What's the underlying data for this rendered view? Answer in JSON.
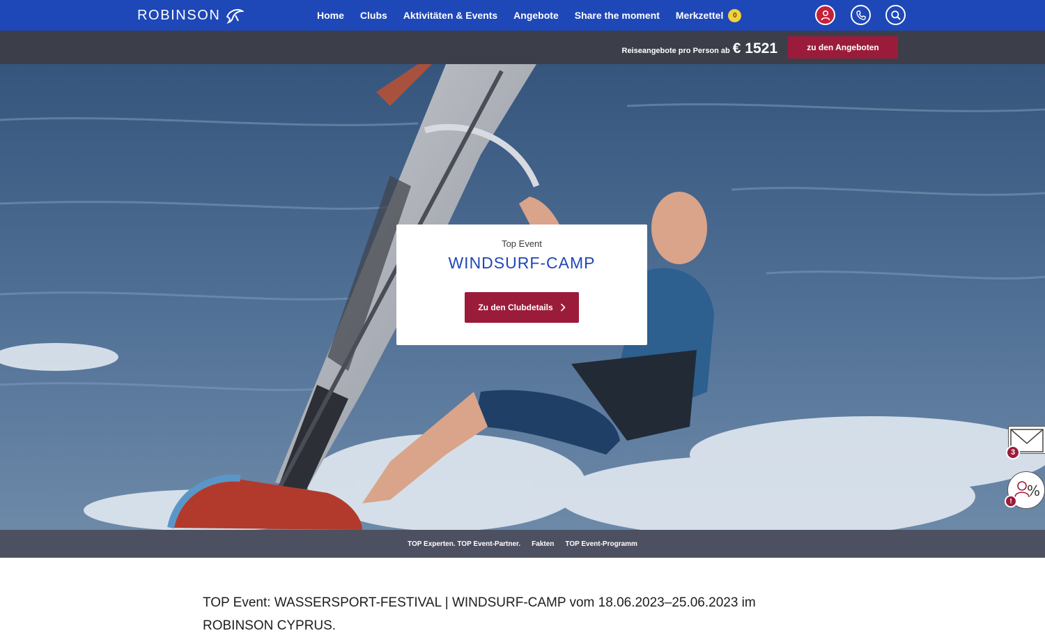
{
  "header": {
    "logo_text": "ROBINSON",
    "nav": [
      {
        "label": "Home"
      },
      {
        "label": "Clubs"
      },
      {
        "label": "Aktivitäten & Events"
      },
      {
        "label": "Angebote"
      },
      {
        "label": "Share the moment"
      },
      {
        "label": "Merkzettel",
        "badge": "0"
      }
    ],
    "icons": [
      "user-icon",
      "phone-icon",
      "search-icon"
    ]
  },
  "offer_bar": {
    "label": "Reiseangebote pro Person ab",
    "price": "€ 1521",
    "button_label": "zu den Angeboten"
  },
  "hero": {
    "kicker": "Top Event",
    "title": "WINDSURF-CAMP",
    "button_label": "Zu den Clubdetails",
    "image_subject": "windsurfer on ocean"
  },
  "side_widgets": {
    "mail_badge": "3",
    "deal_badge": "!"
  },
  "anchor_nav": [
    {
      "label": "TOP Experten. TOP Event-Partner."
    },
    {
      "label": "Fakten"
    },
    {
      "label": "TOP Event-Programm"
    }
  ],
  "intro": {
    "text": "TOP Event: WASSERSPORT-FESTIVAL | WINDSURF-CAMP vom 18.06.2023–25.06.2023 im ROBINSON CYPRUS."
  },
  "colors": {
    "nav_blue": "#1e47b8",
    "offer_bar": "#3c3f4a",
    "accent_red": "#9b1c3a",
    "anchor_bar": "#4d5060"
  }
}
